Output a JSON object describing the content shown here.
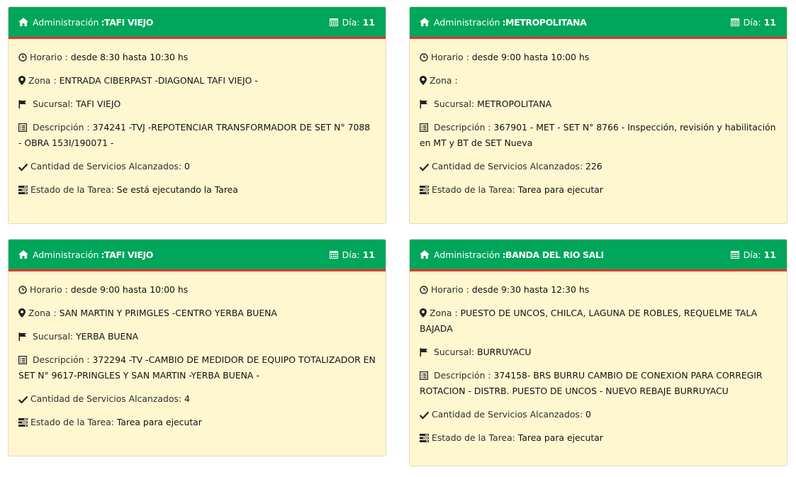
{
  "cards": [
    {
      "admin_label": "Administración",
      "admin_value": ":TAFI VIEJO",
      "day_label": "Día:",
      "day_value": "11",
      "horario_label": "Horario :",
      "horario_value": "desde 8:30 hasta 10:30 hs",
      "zona_label": "Zona :",
      "zona_value": "ENTRADA CIBERPAST -DIAGONAL TAFI VIEJO -",
      "sucursal_label": "Sucursal:",
      "sucursal_value": "TAFI VIEJO",
      "descripcion_label": "Descripción :",
      "descripcion_value": "374241 -TVJ -REPOTENCIAR TRANSFORMADOR DE SET N° 7088 - OBRA 153I/190071 -",
      "cantidad_label": "Cantidad de Servicios Alcanzados:",
      "cantidad_value": "0",
      "estado_label": "Estado de la Tarea:",
      "estado_value": "Se está ejecutando la Tarea"
    },
    {
      "admin_label": "Administración",
      "admin_value": ":METROPOLITANA",
      "day_label": "Día:",
      "day_value": "11",
      "horario_label": "Horario :",
      "horario_value": "desde 9:00 hasta 10:00 hs",
      "zona_label": "Zona :",
      "zona_value": "",
      "sucursal_label": "Sucursal:",
      "sucursal_value": "METROPOLITANA",
      "descripcion_label": "Descripción :",
      "descripcion_value": "367901 - MET - SET N° 8766 - Inspección, revisión y habilitación en MT y BT de SET Nueva",
      "cantidad_label": "Cantidad de Servicios Alcanzados:",
      "cantidad_value": "226",
      "estado_label": "Estado de la Tarea:",
      "estado_value": "Tarea para ejecutar"
    },
    {
      "admin_label": "Administración",
      "admin_value": ":TAFI VIEJO",
      "day_label": "Día:",
      "day_value": "11",
      "horario_label": "Horario :",
      "horario_value": "desde 9:00 hasta 10:00 hs",
      "zona_label": "Zona :",
      "zona_value": "SAN MARTIN Y PRIMGLES -CENTRO YERBA BUENA",
      "sucursal_label": "Sucursal:",
      "sucursal_value": "YERBA BUENA",
      "descripcion_label": "Descripción :",
      "descripcion_value": "372294 -TV -CAMBIO DE MEDIDOR DE EQUIPO TOTALIZADOR EN SET N° 9617-PRINGLES Y SAN MARTIN -YERBA BUENA -",
      "cantidad_label": "Cantidad de Servicios Alcanzados:",
      "cantidad_value": "4",
      "estado_label": "Estado de la Tarea:",
      "estado_value": "Tarea para ejecutar"
    },
    {
      "admin_label": "Administración",
      "admin_value": ":BANDA DEL RIO SALI",
      "day_label": "Día:",
      "day_value": "11",
      "horario_label": "Horario :",
      "horario_value": "desde 9:30 hasta 12:30 hs",
      "zona_label": "Zona :",
      "zona_value": "PUESTO DE UNCOS, CHILCA, LAGUNA DE ROBLES, REQUELME TALA BAJADA",
      "sucursal_label": "Sucursal:",
      "sucursal_value": "BURRUYACU",
      "descripcion_label": "Descripción :",
      "descripcion_value": "374158- BRS BURRU CAMBIO DE CONEXION PARA CORREGIR ROTACION - DISTRB. PUESTO DE UNCOS - NUEVO REBAJE BURRUYACU",
      "cantidad_label": "Cantidad de Servicios Alcanzados:",
      "cantidad_value": "0",
      "estado_label": "Estado de la Tarea:",
      "estado_value": "Tarea para ejecutar"
    }
  ],
  "icons": {
    "header_left": "home-icon",
    "header_right": "calendar-icon",
    "horario": "clock-icon",
    "zona": "map-marker-icon",
    "sucursal": "flag-icon",
    "descripcion": "list-alt-icon",
    "cantidad": "check-icon",
    "estado": "tasks-icon"
  },
  "colors": {
    "header_bg": "#00a65a",
    "header_border": "#e3342f",
    "card_bg": "#fff7d0"
  }
}
